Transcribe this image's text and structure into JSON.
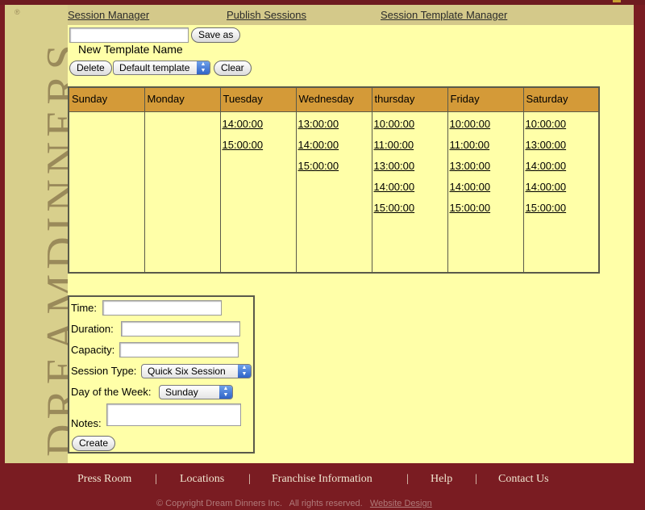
{
  "brand": {
    "name": "DREAMDINNERS",
    "reg": "®"
  },
  "topnav": {
    "session_manager": "Session Manager",
    "publish_sessions": "Publish Sessions",
    "session_template_manager": "Session Template Manager"
  },
  "template": {
    "name_value": "",
    "save_as_label": "Save as",
    "new_template_label": "New Template Name",
    "delete_label": "Delete",
    "selected_template": "Default template",
    "clear_label": "Clear"
  },
  "schedule": {
    "days": [
      "Sunday",
      "Monday",
      "Tuesday",
      "Wednesday",
      "thursday",
      "Friday",
      "Saturday"
    ],
    "times": [
      [],
      [],
      [
        "14:00:00",
        "15:00:00"
      ],
      [
        "13:00:00",
        "14:00:00",
        "15:00:00"
      ],
      [
        "10:00:00",
        "11:00:00",
        "13:00:00",
        "14:00:00",
        "15:00:00"
      ],
      [
        "10:00:00",
        "11:00:00",
        "13:00:00",
        "14:00:00",
        "15:00:00"
      ],
      [
        "10:00:00",
        "13:00:00",
        "14:00:00",
        "14:00:00",
        "15:00:00"
      ]
    ]
  },
  "form": {
    "time_label": "Time:",
    "time_value": "",
    "duration_label": "Duration:",
    "duration_value": "",
    "capacity_label": "Capacity:",
    "capacity_value": "",
    "session_type_label": "Session Type:",
    "session_type_value": "Quick Six Session",
    "day_label": "Day of the Week:",
    "day_value": "Sunday",
    "notes_label": "Notes:",
    "notes_value": "",
    "create_label": "Create"
  },
  "footer": {
    "links": [
      "Press Room",
      "Locations",
      "Franchise Information",
      "Help",
      "Contact Us"
    ],
    "separator": "|",
    "copyright": "© Copyright Dream Dinners Inc.   All rights reserved.",
    "website_design": "Website Design"
  },
  "colors": {
    "background": "#7a1c22",
    "content": "#ffffa8",
    "header_cell": "#d49a38",
    "brand_column": "#d8cf8c",
    "nav_bar": "#d4c98a"
  }
}
